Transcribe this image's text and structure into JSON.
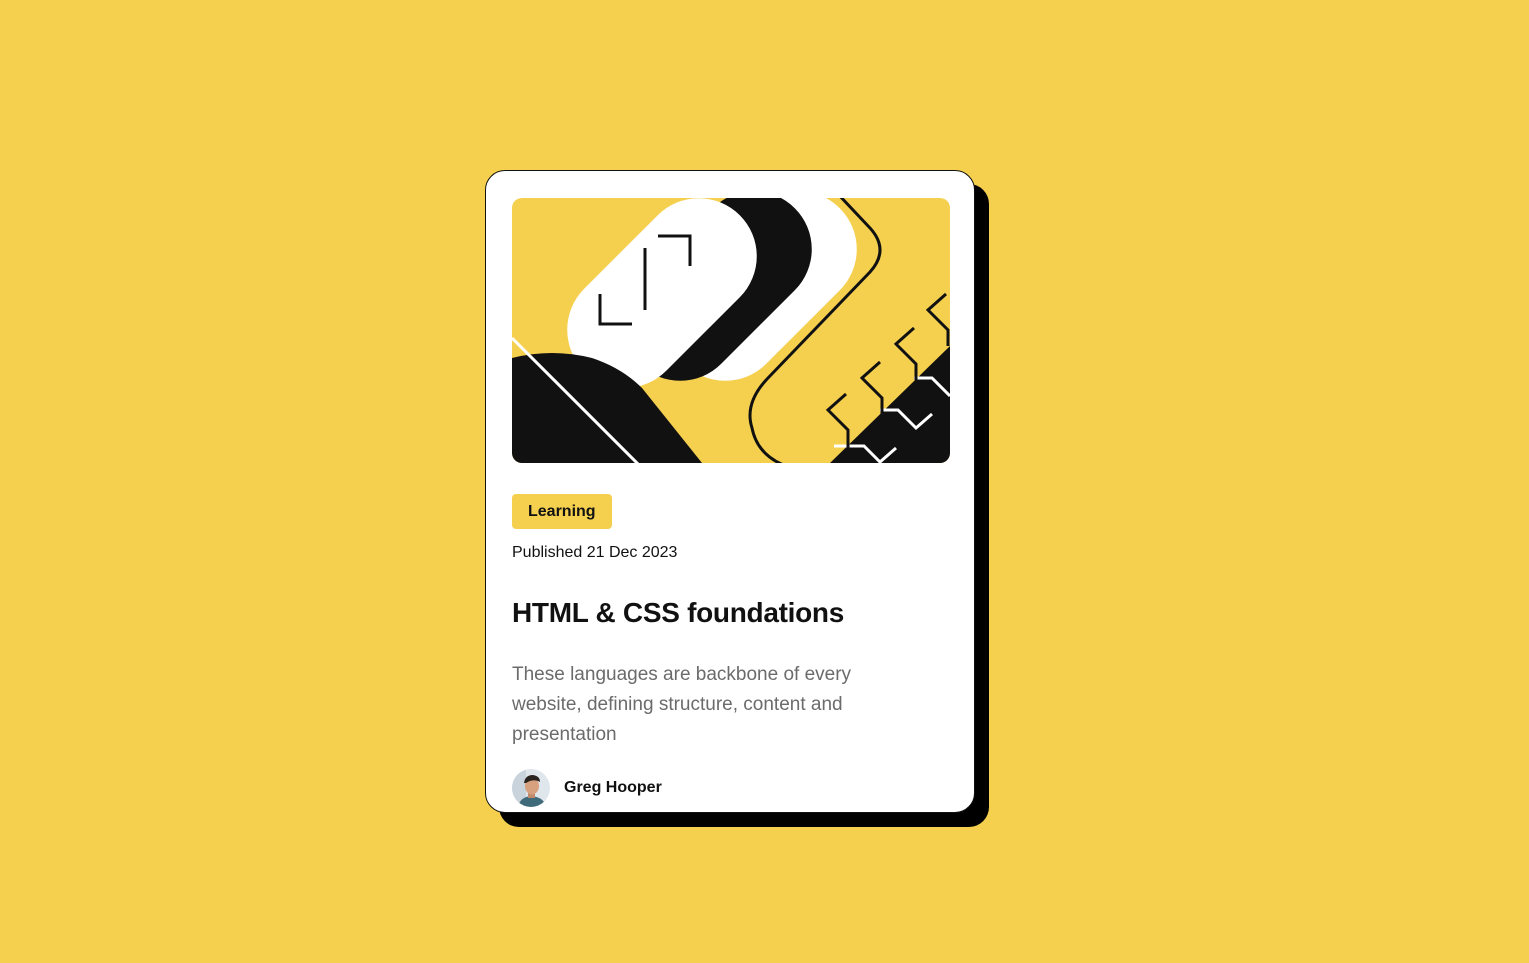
{
  "card": {
    "tag": "Learning",
    "published": "Published 21 Dec 2023",
    "title": "HTML & CSS foundations",
    "description": "These languages are backbone of every website, defining structure, content and presentation",
    "author": {
      "name": "Greg Hooper"
    }
  },
  "colors": {
    "background": "#f5d04f",
    "card": "#ffffff",
    "ink": "#111111",
    "muted": "#6b6b6b",
    "accent": "#f5d04f"
  },
  "icons": {
    "hero": "abstract-illustration",
    "avatar": "author-avatar"
  }
}
